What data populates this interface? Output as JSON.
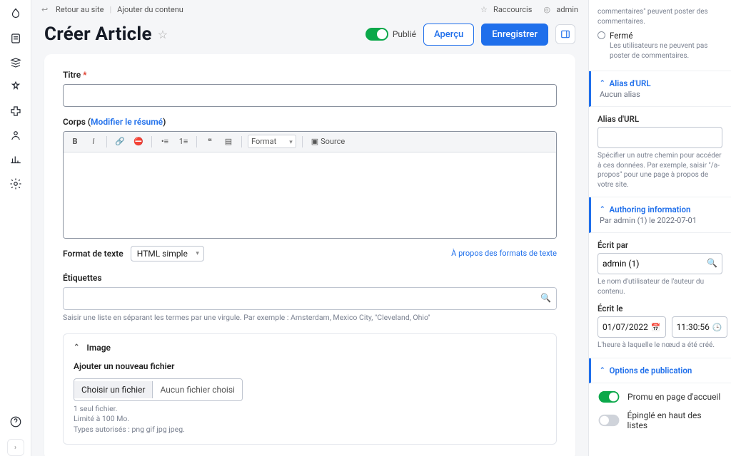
{
  "topbar": {
    "back": "Retour au site",
    "add_content": "Ajouter du contenu",
    "shortcuts": "Raccourcis",
    "user": "admin"
  },
  "header": {
    "title": "Créer Article",
    "published_label": "Publié",
    "preview": "Aperçu",
    "save": "Enregistrer"
  },
  "form": {
    "title_label": "Titre",
    "body_label": "Corps",
    "body_summary_link": "Modifier le résumé",
    "toolbar_format": "Format",
    "toolbar_source": "Source",
    "text_format_label": "Format de texte",
    "text_format_value": "HTML simple",
    "about_formats": "À propos des formats de texte",
    "tags_label": "Étiquettes",
    "tags_help": "Saisir une liste en séparant les termes par une virgule. Par exemple : Amsterdam, Mexico City, \"Cleveland, Ohio\"",
    "image_header": "Image",
    "file_header": "Ajouter un nouveau fichier",
    "file_button": "Choisir un fichier",
    "file_status": "Aucun fichier choisi",
    "file_help1": "1 seul fichier.",
    "file_help2": "Limité à 100 Mo.",
    "file_help3": "Types autorisés : png gif jpg jpeg."
  },
  "sidebar": {
    "comments_help_top": "commentaires\" peuvent poster des commentaires.",
    "closed_label": "Fermé",
    "closed_help": "Les utilisateurs ne peuvent pas poster de commentaires.",
    "url_alias_head": "Alias d'URL",
    "url_alias_sub": "Aucun alias",
    "url_alias_field": "Alias d'URL",
    "url_alias_help": "Spécifier un autre chemin pour accéder à ces données. Par exemple, saisir \"/a-propos\" pour une page à propos de votre site.",
    "authoring_head": "Authoring information",
    "authoring_sub": "Par admin (1) le 2022-07-01",
    "authored_by_label": "Écrit par",
    "authored_by_value": "admin (1)",
    "authored_by_help": "Le nom d'utilisateur de l'auteur du contenu.",
    "authored_on_label": "Écrit le",
    "authored_on_date": "01/07/2022",
    "authored_on_time": "11:30:56",
    "authored_on_help": "L'heure à laquelle le nœud a été créé.",
    "publish_head": "Options de publication",
    "promote": "Promu en page d'accueil",
    "sticky": "Épinglé en haut des listes"
  }
}
